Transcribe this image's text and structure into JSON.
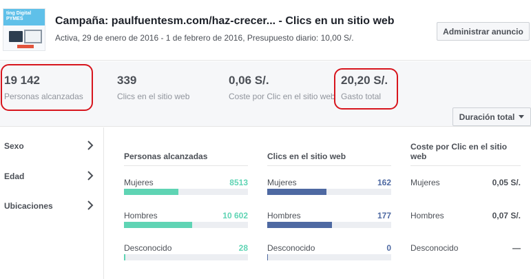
{
  "header": {
    "thumbnail_text": "ting Digital PYMES",
    "title": "Campaña: paulfuentesm.com/haz-crecer... - Clics en un sitio web",
    "subtitle": "Activa, 29 de enero de 2016 - 1 de febrero de 2016, Presupuesto diario: 10,00 S/.",
    "manage_button": "Administrar anuncio"
  },
  "stats": [
    {
      "value": "19 142",
      "label": "Personas alcanzadas",
      "highlighted": true
    },
    {
      "value": "339",
      "label": "Clics en el sitio web",
      "highlighted": false
    },
    {
      "value": "0,06 S/.",
      "label": "Coste por Clic en el sitio web",
      "highlighted": false
    },
    {
      "value": "20,20 S/.",
      "label": "Gasto total",
      "highlighted": true
    }
  ],
  "duration_button": "Duración total",
  "sidebar": {
    "items": [
      {
        "label": "Sexo"
      },
      {
        "label": "Edad"
      },
      {
        "label": "Ubicaciones"
      }
    ]
  },
  "columns": [
    {
      "heading": "Personas alcanzadas",
      "color": "#5fd4b4",
      "rows": [
        {
          "label": "Mujeres",
          "value": "8513",
          "fraction": 0.44
        },
        {
          "label": "Hombres",
          "value": "10 602",
          "fraction": 0.55
        },
        {
          "label": "Desconocido",
          "value": "28",
          "fraction": 0.01
        }
      ]
    },
    {
      "heading": "Clics en el sitio web",
      "color": "#4e69a2",
      "rows": [
        {
          "label": "Mujeres",
          "value": "162",
          "fraction": 0.48
        },
        {
          "label": "Hombres",
          "value": "177",
          "fraction": 0.52
        },
        {
          "label": "Desconocido",
          "value": "0",
          "fraction": 0
        }
      ]
    },
    {
      "heading": "Coste por Clic en el sitio web",
      "color": "#4b4f56",
      "rows": [
        {
          "label": "Mujeres",
          "value": "0,05 S/."
        },
        {
          "label": "Hombres",
          "value": "0,07 S/."
        },
        {
          "label": "Desconocido",
          "value": "—"
        }
      ]
    }
  ],
  "colors": {
    "highlight_circle": "#d7141c",
    "reach_bar": "#5fd4b4",
    "clicks_bar": "#4e69a2"
  }
}
